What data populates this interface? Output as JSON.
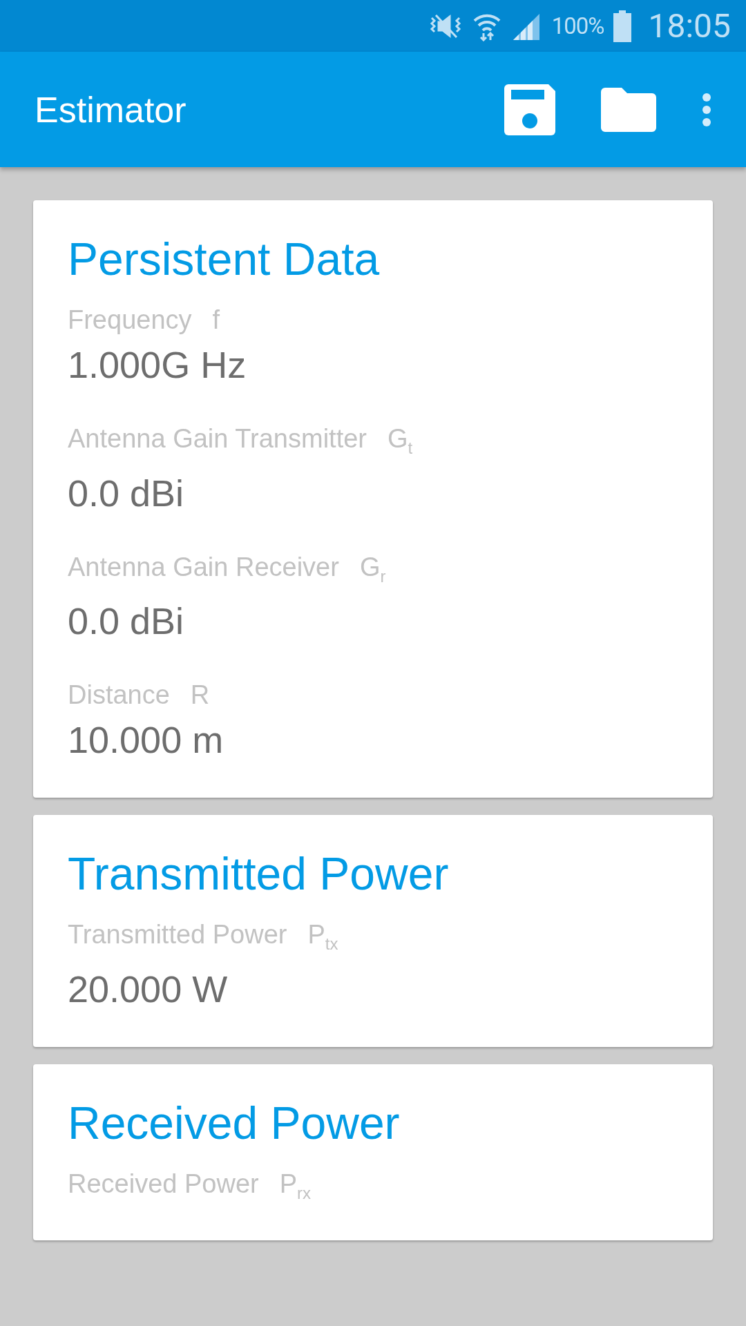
{
  "status_bar": {
    "battery": "100%",
    "time": "18:05"
  },
  "app_bar": {
    "title": "Estimator"
  },
  "cards": [
    {
      "title": "Persistent Data",
      "fields": [
        {
          "label": "Frequency",
          "symbol": "f",
          "value": "1.000G Hz"
        },
        {
          "label": "Antenna Gain Transmitter",
          "symbol": "G$_{t}$",
          "value": "0.0 dBi"
        },
        {
          "label": "Antenna Gain Receiver",
          "symbol": "G$_{r}$",
          "value": "0.0 dBi"
        },
        {
          "label": "Distance",
          "symbol": "R",
          "value": "10.000 m"
        }
      ]
    },
    {
      "title": "Transmitted Power",
      "fields": [
        {
          "label": "Transmitted Power",
          "symbol": "P$_{tx}$",
          "value": "20.000 W"
        }
      ]
    },
    {
      "title": "Received Power",
      "fields": [
        {
          "label": "Received Power",
          "symbol": "P$_{rx}$"
        }
      ]
    }
  ]
}
